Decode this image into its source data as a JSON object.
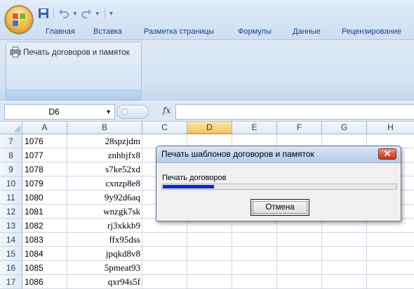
{
  "app": {
    "tabs": [
      "Главная",
      "Вставка",
      "Разметка страницы",
      "Формулы",
      "Данные",
      "Рецензирование"
    ],
    "accent": "#15428b"
  },
  "ribbon": {
    "command_label": "Печать договоров и памяток"
  },
  "formula_bar": {
    "name_box": "D6",
    "fx": "fx",
    "content": ""
  },
  "grid": {
    "columns": [
      "A",
      "B",
      "C",
      "D",
      "E",
      "F",
      "G",
      "H"
    ],
    "selected_column": "D",
    "rows": [
      {
        "num": "7",
        "a": "1076",
        "b": "28spzjdm"
      },
      {
        "num": "8",
        "a": "1077",
        "b": "znhbjfx8"
      },
      {
        "num": "9",
        "a": "1078",
        "b": "s7ke52xd"
      },
      {
        "num": "10",
        "a": "1079",
        "b": "cxnzp8e8"
      },
      {
        "num": "11",
        "a": "1080",
        "b": "9y92d6aq"
      },
      {
        "num": "12",
        "a": "1081",
        "b": "wnzgk7sk"
      },
      {
        "num": "13",
        "a": "1082",
        "b": "rj3xkkb9"
      },
      {
        "num": "14",
        "a": "1083",
        "b": "ffx95dss"
      },
      {
        "num": "15",
        "a": "1084",
        "b": "jpqkd8v8"
      },
      {
        "num": "16",
        "a": "1085",
        "b": "5pmeat93"
      },
      {
        "num": "17",
        "a": "1086",
        "b": "qxr94s5f"
      }
    ]
  },
  "dialog": {
    "title": "Печать шаблонов договоров и памяток",
    "status": "Печать договоров",
    "progress_fraction": 0.22,
    "cancel_label": "Отмена",
    "progress_color": "#0a2ad8"
  }
}
